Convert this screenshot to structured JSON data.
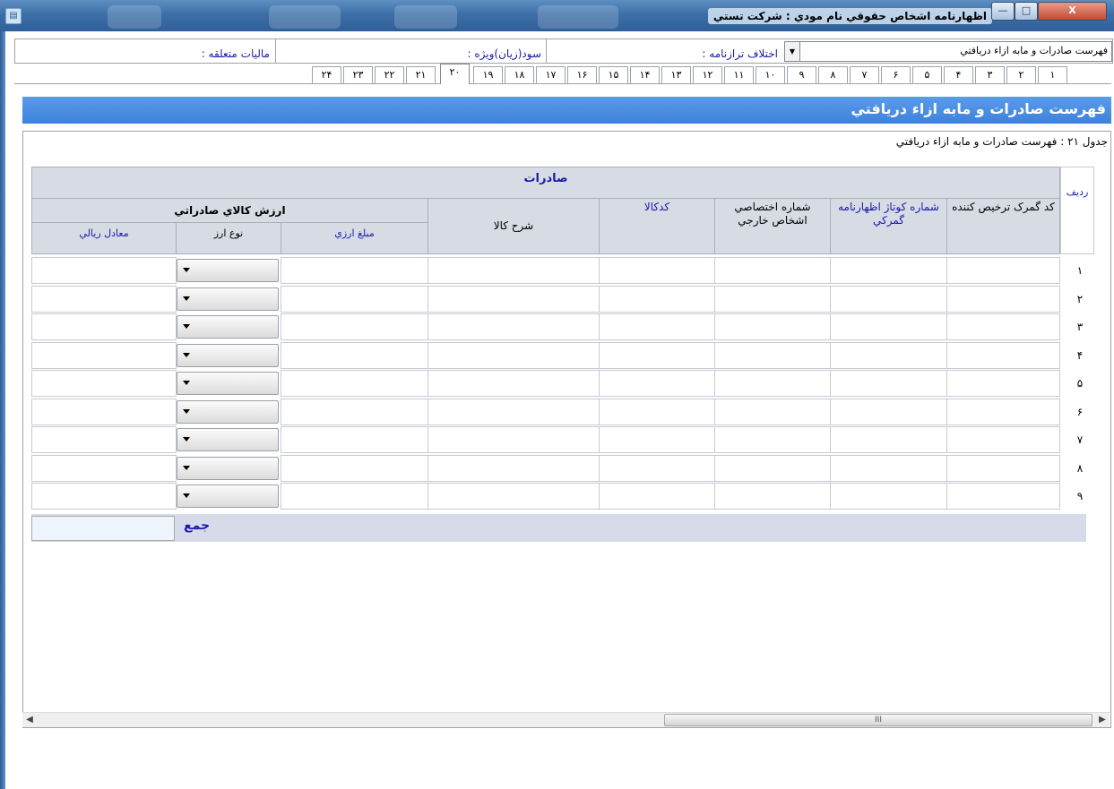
{
  "window": {
    "title": "اظهارنامه اشخاص حقوقي   نام مودي :  شركت تستي",
    "controls": {
      "minimize": "—",
      "maximize": "□",
      "close": "X"
    }
  },
  "header": {
    "combo_value": "فهرست صادرات و مابه ازاء دريافتي",
    "labels": [
      "اختلاف ترازنامه :",
      "سود(زيان)ويژه :",
      "ماليات متعلقه :"
    ]
  },
  "tabs": [
    "۱",
    "۲",
    "۳",
    "۴",
    "۵",
    "۶",
    "۷",
    "۸",
    "۹",
    "۱۰",
    "۱۱",
    "۱۲",
    "۱۳",
    "۱۴",
    "۱۵",
    "۱۶",
    "۱۷",
    "۱۸",
    "۱۹",
    "۲۰",
    "۲۱",
    "۲۲",
    "۲۳",
    "۲۴"
  ],
  "active_tab": "۲۰",
  "page_title": "فهرست صادرات و مابه ازاء دريافتي",
  "table": {
    "caption": "جدول ۲۱ : فهرست صادرات و مابه ازاء دريافتي",
    "row_header": "رديف",
    "group_header": "صادرات",
    "columns": {
      "customs_code": "كد گمرک ترخيص كننده",
      "cotaj_number": "شماره كوتاژ اظهارنامه گمركي",
      "foreign_id": "شماره اختصاصي اشخاص خارجي",
      "product_code": "كدكالا",
      "description": "شرح كالا",
      "value_group": "ارزش كالاي صادراتي",
      "fx_amount": "مبلغ ارزي",
      "currency_type": "نوع ارز",
      "rial_equiv": "معادل ريالي"
    },
    "rows": [
      "۱",
      "۲",
      "۳",
      "۴",
      "۵",
      "۶",
      "۷",
      "۸",
      "۹"
    ],
    "sum_label": "جمع"
  },
  "scrollbar": {
    "thumb_label": "III"
  }
}
